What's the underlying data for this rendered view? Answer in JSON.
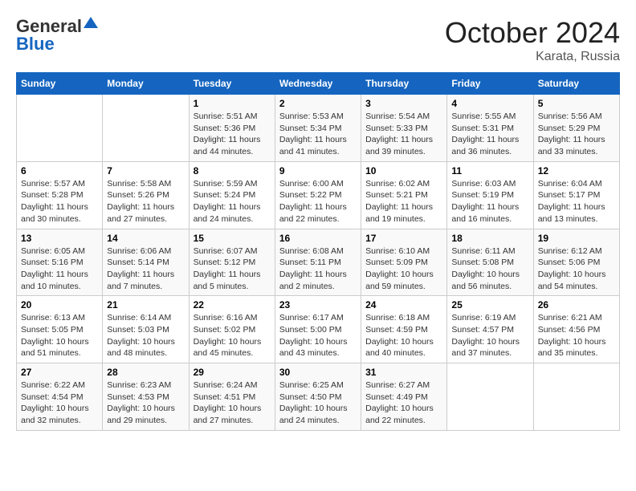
{
  "logo": {
    "general": "General",
    "blue": "Blue"
  },
  "title": "October 2024",
  "location": "Karata, Russia",
  "days_of_week": [
    "Sunday",
    "Monday",
    "Tuesday",
    "Wednesday",
    "Thursday",
    "Friday",
    "Saturday"
  ],
  "weeks": [
    [
      {
        "day": "",
        "sunrise": "",
        "sunset": "",
        "daylight": ""
      },
      {
        "day": "",
        "sunrise": "",
        "sunset": "",
        "daylight": ""
      },
      {
        "day": "1",
        "sunrise": "Sunrise: 5:51 AM",
        "sunset": "Sunset: 5:36 PM",
        "daylight": "Daylight: 11 hours and 44 minutes."
      },
      {
        "day": "2",
        "sunrise": "Sunrise: 5:53 AM",
        "sunset": "Sunset: 5:34 PM",
        "daylight": "Daylight: 11 hours and 41 minutes."
      },
      {
        "day": "3",
        "sunrise": "Sunrise: 5:54 AM",
        "sunset": "Sunset: 5:33 PM",
        "daylight": "Daylight: 11 hours and 39 minutes."
      },
      {
        "day": "4",
        "sunrise": "Sunrise: 5:55 AM",
        "sunset": "Sunset: 5:31 PM",
        "daylight": "Daylight: 11 hours and 36 minutes."
      },
      {
        "day": "5",
        "sunrise": "Sunrise: 5:56 AM",
        "sunset": "Sunset: 5:29 PM",
        "daylight": "Daylight: 11 hours and 33 minutes."
      }
    ],
    [
      {
        "day": "6",
        "sunrise": "Sunrise: 5:57 AM",
        "sunset": "Sunset: 5:28 PM",
        "daylight": "Daylight: 11 hours and 30 minutes."
      },
      {
        "day": "7",
        "sunrise": "Sunrise: 5:58 AM",
        "sunset": "Sunset: 5:26 PM",
        "daylight": "Daylight: 11 hours and 27 minutes."
      },
      {
        "day": "8",
        "sunrise": "Sunrise: 5:59 AM",
        "sunset": "Sunset: 5:24 PM",
        "daylight": "Daylight: 11 hours and 24 minutes."
      },
      {
        "day": "9",
        "sunrise": "Sunrise: 6:00 AM",
        "sunset": "Sunset: 5:22 PM",
        "daylight": "Daylight: 11 hours and 22 minutes."
      },
      {
        "day": "10",
        "sunrise": "Sunrise: 6:02 AM",
        "sunset": "Sunset: 5:21 PM",
        "daylight": "Daylight: 11 hours and 19 minutes."
      },
      {
        "day": "11",
        "sunrise": "Sunrise: 6:03 AM",
        "sunset": "Sunset: 5:19 PM",
        "daylight": "Daylight: 11 hours and 16 minutes."
      },
      {
        "day": "12",
        "sunrise": "Sunrise: 6:04 AM",
        "sunset": "Sunset: 5:17 PM",
        "daylight": "Daylight: 11 hours and 13 minutes."
      }
    ],
    [
      {
        "day": "13",
        "sunrise": "Sunrise: 6:05 AM",
        "sunset": "Sunset: 5:16 PM",
        "daylight": "Daylight: 11 hours and 10 minutes."
      },
      {
        "day": "14",
        "sunrise": "Sunrise: 6:06 AM",
        "sunset": "Sunset: 5:14 PM",
        "daylight": "Daylight: 11 hours and 7 minutes."
      },
      {
        "day": "15",
        "sunrise": "Sunrise: 6:07 AM",
        "sunset": "Sunset: 5:12 PM",
        "daylight": "Daylight: 11 hours and 5 minutes."
      },
      {
        "day": "16",
        "sunrise": "Sunrise: 6:08 AM",
        "sunset": "Sunset: 5:11 PM",
        "daylight": "Daylight: 11 hours and 2 minutes."
      },
      {
        "day": "17",
        "sunrise": "Sunrise: 6:10 AM",
        "sunset": "Sunset: 5:09 PM",
        "daylight": "Daylight: 10 hours and 59 minutes."
      },
      {
        "day": "18",
        "sunrise": "Sunrise: 6:11 AM",
        "sunset": "Sunset: 5:08 PM",
        "daylight": "Daylight: 10 hours and 56 minutes."
      },
      {
        "day": "19",
        "sunrise": "Sunrise: 6:12 AM",
        "sunset": "Sunset: 5:06 PM",
        "daylight": "Daylight: 10 hours and 54 minutes."
      }
    ],
    [
      {
        "day": "20",
        "sunrise": "Sunrise: 6:13 AM",
        "sunset": "Sunset: 5:05 PM",
        "daylight": "Daylight: 10 hours and 51 minutes."
      },
      {
        "day": "21",
        "sunrise": "Sunrise: 6:14 AM",
        "sunset": "Sunset: 5:03 PM",
        "daylight": "Daylight: 10 hours and 48 minutes."
      },
      {
        "day": "22",
        "sunrise": "Sunrise: 6:16 AM",
        "sunset": "Sunset: 5:02 PM",
        "daylight": "Daylight: 10 hours and 45 minutes."
      },
      {
        "day": "23",
        "sunrise": "Sunrise: 6:17 AM",
        "sunset": "Sunset: 5:00 PM",
        "daylight": "Daylight: 10 hours and 43 minutes."
      },
      {
        "day": "24",
        "sunrise": "Sunrise: 6:18 AM",
        "sunset": "Sunset: 4:59 PM",
        "daylight": "Daylight: 10 hours and 40 minutes."
      },
      {
        "day": "25",
        "sunrise": "Sunrise: 6:19 AM",
        "sunset": "Sunset: 4:57 PM",
        "daylight": "Daylight: 10 hours and 37 minutes."
      },
      {
        "day": "26",
        "sunrise": "Sunrise: 6:21 AM",
        "sunset": "Sunset: 4:56 PM",
        "daylight": "Daylight: 10 hours and 35 minutes."
      }
    ],
    [
      {
        "day": "27",
        "sunrise": "Sunrise: 6:22 AM",
        "sunset": "Sunset: 4:54 PM",
        "daylight": "Daylight: 10 hours and 32 minutes."
      },
      {
        "day": "28",
        "sunrise": "Sunrise: 6:23 AM",
        "sunset": "Sunset: 4:53 PM",
        "daylight": "Daylight: 10 hours and 29 minutes."
      },
      {
        "day": "29",
        "sunrise": "Sunrise: 6:24 AM",
        "sunset": "Sunset: 4:51 PM",
        "daylight": "Daylight: 10 hours and 27 minutes."
      },
      {
        "day": "30",
        "sunrise": "Sunrise: 6:25 AM",
        "sunset": "Sunset: 4:50 PM",
        "daylight": "Daylight: 10 hours and 24 minutes."
      },
      {
        "day": "31",
        "sunrise": "Sunrise: 6:27 AM",
        "sunset": "Sunset: 4:49 PM",
        "daylight": "Daylight: 10 hours and 22 minutes."
      },
      {
        "day": "",
        "sunrise": "",
        "sunset": "",
        "daylight": ""
      },
      {
        "day": "",
        "sunrise": "",
        "sunset": "",
        "daylight": ""
      }
    ]
  ]
}
